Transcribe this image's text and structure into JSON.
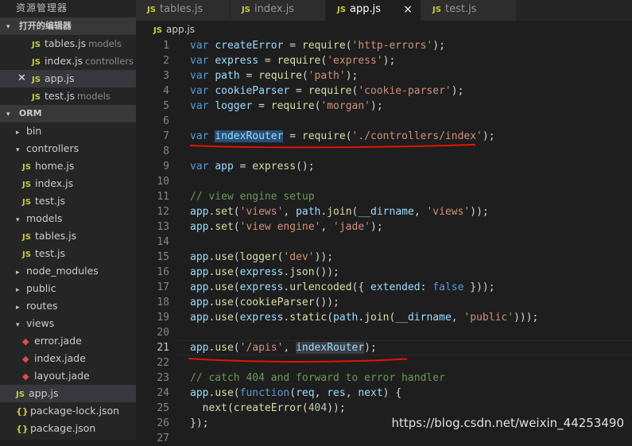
{
  "explorer": {
    "title": "资源管理器",
    "open_editors": {
      "label": "打开的编辑器",
      "items": [
        {
          "name": "tables.js",
          "folder": "models",
          "icon": "JS",
          "closable": false
        },
        {
          "name": "index.js",
          "folder": "controllers",
          "icon": "JS",
          "closable": false
        },
        {
          "name": "app.js",
          "folder": "",
          "icon": "JS",
          "closable": true
        },
        {
          "name": "test.js",
          "folder": "models",
          "icon": "JS",
          "closable": false
        }
      ]
    },
    "project": {
      "label": "ORM",
      "tree": [
        {
          "name": "bin",
          "type": "folder",
          "expanded": false
        },
        {
          "name": "controllers",
          "type": "folder",
          "expanded": true
        },
        {
          "name": "home.js",
          "type": "js"
        },
        {
          "name": "index.js",
          "type": "js"
        },
        {
          "name": "test.js",
          "type": "js"
        },
        {
          "name": "models",
          "type": "folder",
          "expanded": true
        },
        {
          "name": "tables.js",
          "type": "js"
        },
        {
          "name": "test.js",
          "type": "js"
        },
        {
          "name": "node_modules",
          "type": "folder",
          "expanded": false
        },
        {
          "name": "public",
          "type": "folder",
          "expanded": false
        },
        {
          "name": "routes",
          "type": "folder",
          "expanded": false
        },
        {
          "name": "views",
          "type": "folder",
          "expanded": true
        },
        {
          "name": "error.jade",
          "type": "jade"
        },
        {
          "name": "index.jade",
          "type": "jade"
        },
        {
          "name": "layout.jade",
          "type": "jade"
        },
        {
          "name": "app.js",
          "type": "js",
          "selected": true
        },
        {
          "name": "package-lock.json",
          "type": "json"
        },
        {
          "name": "package.json",
          "type": "json"
        }
      ]
    }
  },
  "tabs": [
    {
      "label": "tables.js",
      "icon": "JS",
      "active": false
    },
    {
      "label": "index.js",
      "icon": "JS",
      "active": false
    },
    {
      "label": "app.js",
      "icon": "JS",
      "active": true,
      "close": "×"
    },
    {
      "label": "test.js",
      "icon": "JS",
      "active": false
    }
  ],
  "breadcrumb": {
    "icon": "JS",
    "file": "app.js"
  },
  "editor": {
    "current_line": 21,
    "lines": [
      {
        "n": "1",
        "tokens": [
          [
            "k",
            "var "
          ],
          [
            "v",
            "createError"
          ],
          [
            "b",
            " = "
          ],
          [
            "f",
            "require"
          ],
          [
            "b",
            "("
          ],
          [
            "s",
            "'http-errors'"
          ],
          [
            "b",
            ");"
          ]
        ]
      },
      {
        "n": "2",
        "tokens": [
          [
            "k",
            "var "
          ],
          [
            "v",
            "express"
          ],
          [
            "b",
            " = "
          ],
          [
            "f",
            "require"
          ],
          [
            "b",
            "("
          ],
          [
            "s",
            "'express'"
          ],
          [
            "b",
            ");"
          ]
        ]
      },
      {
        "n": "3",
        "tokens": [
          [
            "k",
            "var "
          ],
          [
            "v",
            "path"
          ],
          [
            "b",
            " = "
          ],
          [
            "f",
            "require"
          ],
          [
            "b",
            "("
          ],
          [
            "s",
            "'path'"
          ],
          [
            "b",
            ");"
          ]
        ]
      },
      {
        "n": "4",
        "tokens": [
          [
            "k",
            "var "
          ],
          [
            "v",
            "cookieParser"
          ],
          [
            "b",
            " = "
          ],
          [
            "f",
            "require"
          ],
          [
            "b",
            "("
          ],
          [
            "s",
            "'cookie-parser'"
          ],
          [
            "b",
            ");"
          ]
        ]
      },
      {
        "n": "5",
        "tokens": [
          [
            "k",
            "var "
          ],
          [
            "v",
            "logger"
          ],
          [
            "b",
            " = "
          ],
          [
            "f",
            "require"
          ],
          [
            "b",
            "("
          ],
          [
            "s",
            "'morgan'"
          ],
          [
            "b",
            ");"
          ]
        ]
      },
      {
        "n": "6",
        "tokens": []
      },
      {
        "n": "7",
        "tokens": [
          [
            "k",
            "var "
          ],
          [
            "v hl",
            "indexRouter"
          ],
          [
            "b",
            " = "
          ],
          [
            "f",
            "require"
          ],
          [
            "b",
            "("
          ],
          [
            "s",
            "'./controllers/index'"
          ],
          [
            "b",
            ");"
          ]
        ]
      },
      {
        "n": "8",
        "tokens": []
      },
      {
        "n": "9",
        "tokens": [
          [
            "k",
            "var "
          ],
          [
            "v",
            "app"
          ],
          [
            "b",
            " = "
          ],
          [
            "f",
            "express"
          ],
          [
            "b",
            "();"
          ]
        ]
      },
      {
        "n": "10",
        "tokens": []
      },
      {
        "n": "11",
        "tokens": [
          [
            "c",
            "// view engine setup"
          ]
        ]
      },
      {
        "n": "12",
        "tokens": [
          [
            "v",
            "app"
          ],
          [
            "b",
            "."
          ],
          [
            "f",
            "set"
          ],
          [
            "b",
            "("
          ],
          [
            "s",
            "'views'"
          ],
          [
            "b",
            ", "
          ],
          [
            "v",
            "path"
          ],
          [
            "b",
            "."
          ],
          [
            "f",
            "join"
          ],
          [
            "b",
            "("
          ],
          [
            "v",
            "__dirname"
          ],
          [
            "b",
            ", "
          ],
          [
            "s",
            "'views'"
          ],
          [
            "b",
            "));"
          ]
        ]
      },
      {
        "n": "13",
        "tokens": [
          [
            "v",
            "app"
          ],
          [
            "b",
            "."
          ],
          [
            "f",
            "set"
          ],
          [
            "b",
            "("
          ],
          [
            "s",
            "'view engine'"
          ],
          [
            "b",
            ", "
          ],
          [
            "s",
            "'jade'"
          ],
          [
            "b",
            ");"
          ]
        ]
      },
      {
        "n": "14",
        "tokens": []
      },
      {
        "n": "15",
        "tokens": [
          [
            "v",
            "app"
          ],
          [
            "b",
            "."
          ],
          [
            "f",
            "use"
          ],
          [
            "b",
            "("
          ],
          [
            "f",
            "logger"
          ],
          [
            "b",
            "("
          ],
          [
            "s",
            "'dev'"
          ],
          [
            "b",
            "));"
          ]
        ]
      },
      {
        "n": "16",
        "tokens": [
          [
            "v",
            "app"
          ],
          [
            "b",
            "."
          ],
          [
            "f",
            "use"
          ],
          [
            "b",
            "("
          ],
          [
            "v",
            "express"
          ],
          [
            "b",
            "."
          ],
          [
            "f",
            "json"
          ],
          [
            "b",
            "());"
          ]
        ]
      },
      {
        "n": "17",
        "tokens": [
          [
            "v",
            "app"
          ],
          [
            "b",
            "."
          ],
          [
            "f",
            "use"
          ],
          [
            "b",
            "("
          ],
          [
            "v",
            "express"
          ],
          [
            "b",
            "."
          ],
          [
            "f",
            "urlencoded"
          ],
          [
            "b",
            "({ "
          ],
          [
            "v",
            "extended"
          ],
          [
            "b",
            ": "
          ],
          [
            "k",
            "false"
          ],
          [
            "b",
            " }));"
          ]
        ]
      },
      {
        "n": "18",
        "tokens": [
          [
            "v",
            "app"
          ],
          [
            "b",
            "."
          ],
          [
            "f",
            "use"
          ],
          [
            "b",
            "("
          ],
          [
            "f",
            "cookieParser"
          ],
          [
            "b",
            "());"
          ]
        ]
      },
      {
        "n": "19",
        "tokens": [
          [
            "v",
            "app"
          ],
          [
            "b",
            "."
          ],
          [
            "f",
            "use"
          ],
          [
            "b",
            "("
          ],
          [
            "v",
            "express"
          ],
          [
            "b",
            "."
          ],
          [
            "f",
            "static"
          ],
          [
            "b",
            "("
          ],
          [
            "v",
            "path"
          ],
          [
            "b",
            "."
          ],
          [
            "f",
            "join"
          ],
          [
            "b",
            "("
          ],
          [
            "v",
            "__dirname"
          ],
          [
            "b",
            ", "
          ],
          [
            "s",
            "'public'"
          ],
          [
            "b",
            ")));"
          ]
        ]
      },
      {
        "n": "20",
        "tokens": []
      },
      {
        "n": "21",
        "tokens": [
          [
            "v",
            "app"
          ],
          [
            "b",
            "."
          ],
          [
            "f",
            "use"
          ],
          [
            "b",
            "("
          ],
          [
            "s",
            "'/apis'"
          ],
          [
            "b",
            ", "
          ],
          [
            "v hl2",
            "indexRouter"
          ],
          [
            "b",
            ");"
          ]
        ]
      },
      {
        "n": "22",
        "tokens": []
      },
      {
        "n": "23",
        "tokens": [
          [
            "c",
            "// catch 404 and forward to error handler"
          ]
        ]
      },
      {
        "n": "24",
        "tokens": [
          [
            "v",
            "app"
          ],
          [
            "b",
            "."
          ],
          [
            "f",
            "use"
          ],
          [
            "b",
            "("
          ],
          [
            "k",
            "function"
          ],
          [
            "b",
            "("
          ],
          [
            "v",
            "req"
          ],
          [
            "b",
            ", "
          ],
          [
            "v",
            "res"
          ],
          [
            "b",
            ", "
          ],
          [
            "v",
            "next"
          ],
          [
            "b",
            ") {"
          ]
        ]
      },
      {
        "n": "25",
        "tokens": [
          [
            "b",
            "  "
          ],
          [
            "f",
            "next"
          ],
          [
            "b",
            "("
          ],
          [
            "f",
            "createError"
          ],
          [
            "b",
            "("
          ],
          [
            "n",
            "404"
          ],
          [
            "b",
            "));"
          ]
        ]
      },
      {
        "n": "26",
        "tokens": [
          [
            "b",
            "});"
          ]
        ]
      },
      {
        "n": "27",
        "tokens": []
      }
    ]
  },
  "watermark": "https://blog.csdn.net/weixin_44253490",
  "colors": {
    "annotation": "#e51400",
    "selection": "#264f78",
    "js_icon": "#cbcb41"
  }
}
